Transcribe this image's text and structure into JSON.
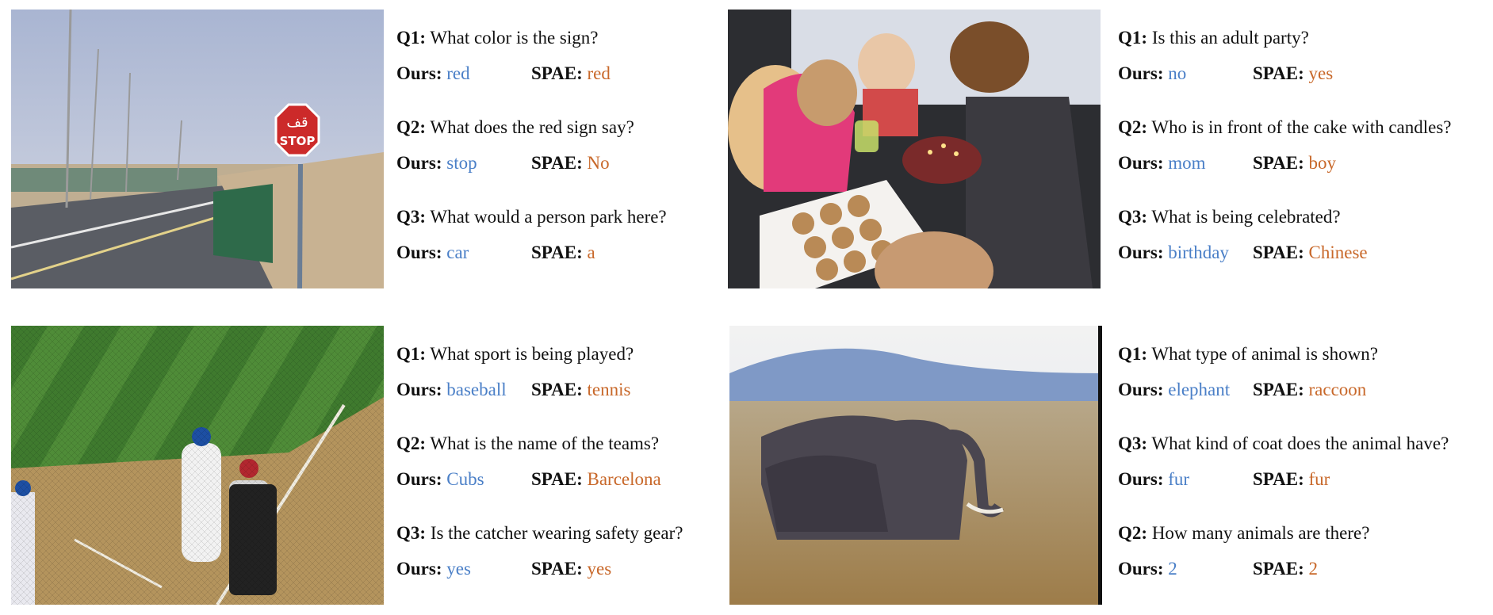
{
  "colors": {
    "ours": "#4a7fc7",
    "spae": "#c8682a"
  },
  "labels": {
    "ours": "Ours:",
    "spae": "SPAE:"
  },
  "images": {
    "stop_sign": {
      "sign_text_arabic": "قف",
      "sign_text": "STOP"
    }
  },
  "panels": [
    {
      "questions": [
        {
          "id": "Q1:",
          "text": "What color is the sign?",
          "ours": "red",
          "spae": "red"
        },
        {
          "id": "Q2:",
          "text": "What does the red sign say?",
          "ours": "stop",
          "spae": "No"
        },
        {
          "id": "Q3:",
          "text": "What would a person park here?",
          "ours": "car",
          "spae": "a"
        }
      ]
    },
    {
      "questions": [
        {
          "id": "Q1:",
          "text": "Is this an adult party?",
          "ours": "no",
          "spae": "yes"
        },
        {
          "id": "Q2:",
          "text": "Who is in front of the cake with candles?",
          "ours": "mom",
          "spae": "boy"
        },
        {
          "id": "Q3:",
          "text": "What is being celebrated?",
          "ours": "birthday",
          "spae": "Chinese"
        }
      ]
    },
    {
      "questions": [
        {
          "id": "Q1:",
          "text": "What sport is being played?",
          "ours": "baseball",
          "spae": "tennis"
        },
        {
          "id": "Q2:",
          "text": "What is the name of the teams?",
          "ours": "Cubs",
          "spae": "Barcelona"
        },
        {
          "id": "Q3:",
          "text": "Is the catcher wearing safety gear?",
          "ours": "yes",
          "spae": "yes"
        }
      ]
    },
    {
      "questions": [
        {
          "id": "Q1:",
          "text": "What type of animal is shown?",
          "ours": "elephant",
          "spae": "raccoon"
        },
        {
          "id": "Q3:",
          "text": "What kind of coat does the animal have?",
          "ours": "fur",
          "spae": "fur"
        },
        {
          "id": "Q2:",
          "text": "How many animals are there?",
          "ours": "2",
          "spae": "2"
        }
      ]
    }
  ]
}
